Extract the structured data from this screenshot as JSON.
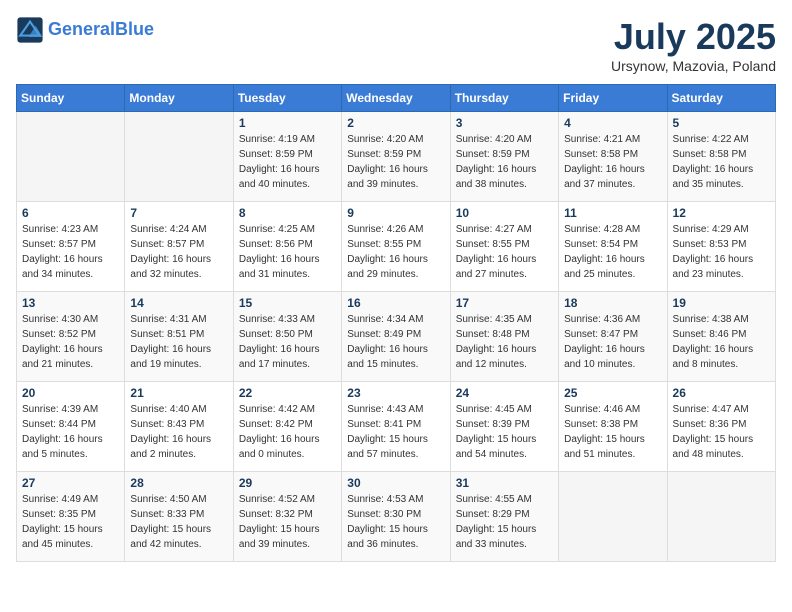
{
  "header": {
    "logo_line1": "General",
    "logo_line2": "Blue",
    "month_title": "July 2025",
    "subtitle": "Ursynow, Mazovia, Poland"
  },
  "weekdays": [
    "Sunday",
    "Monday",
    "Tuesday",
    "Wednesday",
    "Thursday",
    "Friday",
    "Saturday"
  ],
  "weeks": [
    [
      {
        "day": "",
        "detail": ""
      },
      {
        "day": "",
        "detail": ""
      },
      {
        "day": "1",
        "detail": "Sunrise: 4:19 AM\nSunset: 8:59 PM\nDaylight: 16 hours\nand 40 minutes."
      },
      {
        "day": "2",
        "detail": "Sunrise: 4:20 AM\nSunset: 8:59 PM\nDaylight: 16 hours\nand 39 minutes."
      },
      {
        "day": "3",
        "detail": "Sunrise: 4:20 AM\nSunset: 8:59 PM\nDaylight: 16 hours\nand 38 minutes."
      },
      {
        "day": "4",
        "detail": "Sunrise: 4:21 AM\nSunset: 8:58 PM\nDaylight: 16 hours\nand 37 minutes."
      },
      {
        "day": "5",
        "detail": "Sunrise: 4:22 AM\nSunset: 8:58 PM\nDaylight: 16 hours\nand 35 minutes."
      }
    ],
    [
      {
        "day": "6",
        "detail": "Sunrise: 4:23 AM\nSunset: 8:57 PM\nDaylight: 16 hours\nand 34 minutes."
      },
      {
        "day": "7",
        "detail": "Sunrise: 4:24 AM\nSunset: 8:57 PM\nDaylight: 16 hours\nand 32 minutes."
      },
      {
        "day": "8",
        "detail": "Sunrise: 4:25 AM\nSunset: 8:56 PM\nDaylight: 16 hours\nand 31 minutes."
      },
      {
        "day": "9",
        "detail": "Sunrise: 4:26 AM\nSunset: 8:55 PM\nDaylight: 16 hours\nand 29 minutes."
      },
      {
        "day": "10",
        "detail": "Sunrise: 4:27 AM\nSunset: 8:55 PM\nDaylight: 16 hours\nand 27 minutes."
      },
      {
        "day": "11",
        "detail": "Sunrise: 4:28 AM\nSunset: 8:54 PM\nDaylight: 16 hours\nand 25 minutes."
      },
      {
        "day": "12",
        "detail": "Sunrise: 4:29 AM\nSunset: 8:53 PM\nDaylight: 16 hours\nand 23 minutes."
      }
    ],
    [
      {
        "day": "13",
        "detail": "Sunrise: 4:30 AM\nSunset: 8:52 PM\nDaylight: 16 hours\nand 21 minutes."
      },
      {
        "day": "14",
        "detail": "Sunrise: 4:31 AM\nSunset: 8:51 PM\nDaylight: 16 hours\nand 19 minutes."
      },
      {
        "day": "15",
        "detail": "Sunrise: 4:33 AM\nSunset: 8:50 PM\nDaylight: 16 hours\nand 17 minutes."
      },
      {
        "day": "16",
        "detail": "Sunrise: 4:34 AM\nSunset: 8:49 PM\nDaylight: 16 hours\nand 15 minutes."
      },
      {
        "day": "17",
        "detail": "Sunrise: 4:35 AM\nSunset: 8:48 PM\nDaylight: 16 hours\nand 12 minutes."
      },
      {
        "day": "18",
        "detail": "Sunrise: 4:36 AM\nSunset: 8:47 PM\nDaylight: 16 hours\nand 10 minutes."
      },
      {
        "day": "19",
        "detail": "Sunrise: 4:38 AM\nSunset: 8:46 PM\nDaylight: 16 hours\nand 8 minutes."
      }
    ],
    [
      {
        "day": "20",
        "detail": "Sunrise: 4:39 AM\nSunset: 8:44 PM\nDaylight: 16 hours\nand 5 minutes."
      },
      {
        "day": "21",
        "detail": "Sunrise: 4:40 AM\nSunset: 8:43 PM\nDaylight: 16 hours\nand 2 minutes."
      },
      {
        "day": "22",
        "detail": "Sunrise: 4:42 AM\nSunset: 8:42 PM\nDaylight: 16 hours\nand 0 minutes."
      },
      {
        "day": "23",
        "detail": "Sunrise: 4:43 AM\nSunset: 8:41 PM\nDaylight: 15 hours\nand 57 minutes."
      },
      {
        "day": "24",
        "detail": "Sunrise: 4:45 AM\nSunset: 8:39 PM\nDaylight: 15 hours\nand 54 minutes."
      },
      {
        "day": "25",
        "detail": "Sunrise: 4:46 AM\nSunset: 8:38 PM\nDaylight: 15 hours\nand 51 minutes."
      },
      {
        "day": "26",
        "detail": "Sunrise: 4:47 AM\nSunset: 8:36 PM\nDaylight: 15 hours\nand 48 minutes."
      }
    ],
    [
      {
        "day": "27",
        "detail": "Sunrise: 4:49 AM\nSunset: 8:35 PM\nDaylight: 15 hours\nand 45 minutes."
      },
      {
        "day": "28",
        "detail": "Sunrise: 4:50 AM\nSunset: 8:33 PM\nDaylight: 15 hours\nand 42 minutes."
      },
      {
        "day": "29",
        "detail": "Sunrise: 4:52 AM\nSunset: 8:32 PM\nDaylight: 15 hours\nand 39 minutes."
      },
      {
        "day": "30",
        "detail": "Sunrise: 4:53 AM\nSunset: 8:30 PM\nDaylight: 15 hours\nand 36 minutes."
      },
      {
        "day": "31",
        "detail": "Sunrise: 4:55 AM\nSunset: 8:29 PM\nDaylight: 15 hours\nand 33 minutes."
      },
      {
        "day": "",
        "detail": ""
      },
      {
        "day": "",
        "detail": ""
      }
    ]
  ]
}
